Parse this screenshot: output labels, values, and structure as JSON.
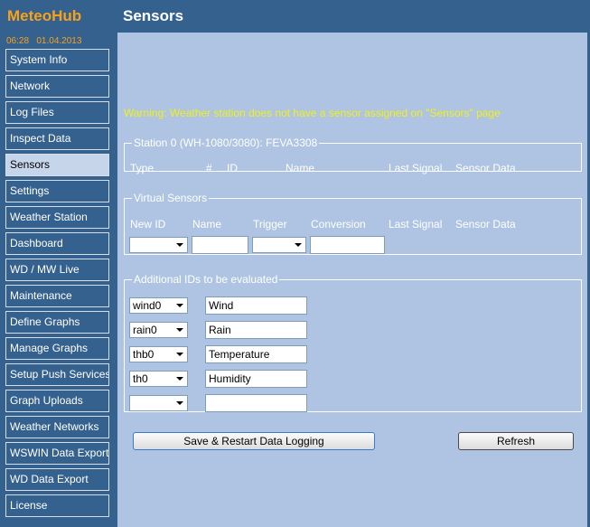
{
  "app": {
    "name": "MeteoHub",
    "datetime": "06:28   01.04.2013"
  },
  "page": {
    "title": "Sensors"
  },
  "nav": [
    {
      "label": "System Info"
    },
    {
      "label": "Network"
    },
    {
      "label": "Log Files"
    },
    {
      "label": "Inspect Data"
    },
    {
      "label": "Sensors",
      "active": true
    },
    {
      "label": "Settings"
    },
    {
      "label": "Weather Station"
    },
    {
      "label": "Dashboard"
    },
    {
      "label": "WD / MW Live"
    },
    {
      "label": "Maintenance"
    },
    {
      "label": "Define Graphs"
    },
    {
      "label": "Manage Graphs"
    },
    {
      "label": "Setup Push Services"
    },
    {
      "label": "Graph Uploads"
    },
    {
      "label": "Weather Networks"
    },
    {
      "label": "WSWIN Data Export"
    },
    {
      "label": "WD Data Export"
    },
    {
      "label": "License"
    }
  ],
  "warning": "Warning: Weather station does not have a sensor assigned on \"Sensors\" page",
  "station": {
    "legend": "Station 0 (WH-1080/3080): FEVA3308",
    "columns": [
      "Type",
      "#",
      "ID",
      "Name",
      "Last Signal",
      "Sensor Data"
    ]
  },
  "virtual": {
    "legend": "Virtual Sensors",
    "columns": [
      "New ID",
      "Name",
      "Trigger",
      "Conversion",
      "Last Signal",
      "Sensor Data"
    ],
    "new_id": "",
    "name": "",
    "trigger": "",
    "conversion": ""
  },
  "additional": {
    "legend": "Additional IDs to be evaluated",
    "rows": [
      {
        "id": "wind0",
        "name": "Wind"
      },
      {
        "id": "rain0",
        "name": "Rain"
      },
      {
        "id": "thb0",
        "name": "Temperature"
      },
      {
        "id": "th0",
        "name": "Humidity"
      },
      {
        "id": "",
        "name": ""
      }
    ]
  },
  "buttons": {
    "save": "Save & Restart Data Logging",
    "refresh": "Refresh"
  },
  "colors": {
    "sidebar_bg": "#35618f",
    "content_bg": "#afc4e2",
    "brand": "#f6a11c",
    "warning": "#f0f01c",
    "active_nav": "#c7d5ea"
  }
}
